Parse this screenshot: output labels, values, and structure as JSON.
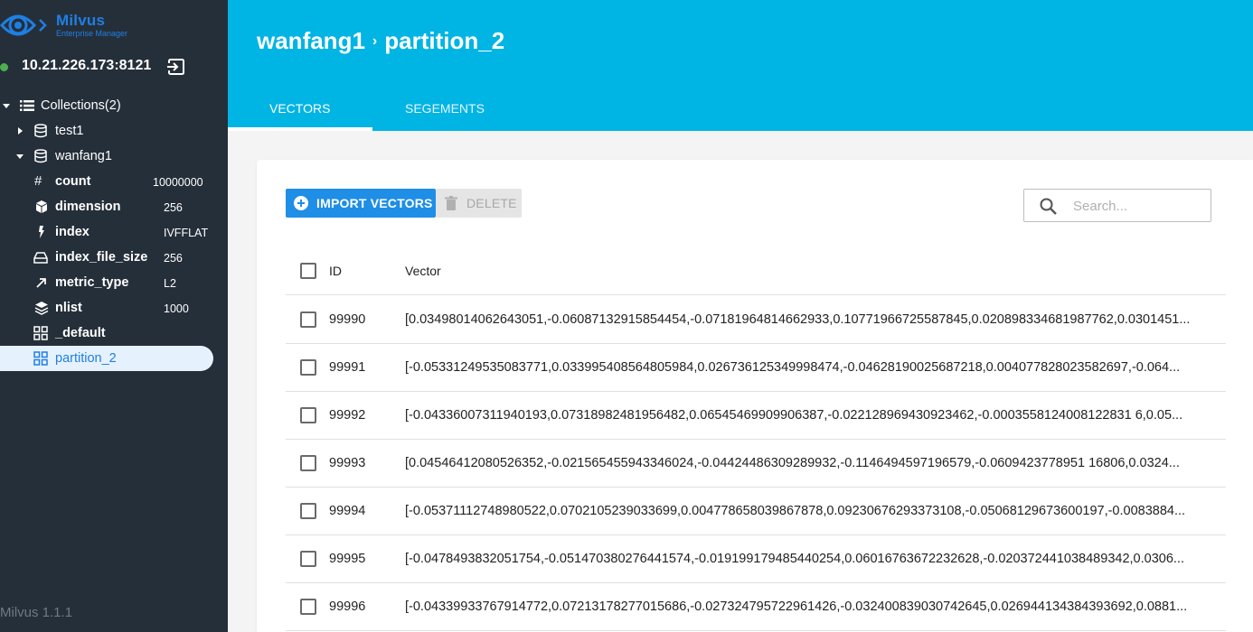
{
  "app": {
    "title": "Milvus",
    "subtitle": "Enterprise Manager",
    "version": "Milvus 1.1.1"
  },
  "connection": {
    "host": "10.21.226.173:8121",
    "status_color": "#4caf50"
  },
  "sidebar": {
    "collections_label": "Collections(2)",
    "collections": [
      {
        "label": "test1",
        "expanded": false
      },
      {
        "label": "wanfang1",
        "expanded": true,
        "properties": [
          {
            "key": "count",
            "value": "10000000",
            "icon": "hash-icon"
          },
          {
            "key": "dimension",
            "value": "256",
            "icon": "cube-icon"
          },
          {
            "key": "index",
            "value": "IVFFLAT",
            "icon": "bolt-icon"
          },
          {
            "key": "index_file_size",
            "value": "256",
            "icon": "drive-icon"
          },
          {
            "key": "metric_type",
            "value": "L2",
            "icon": "arrow-up-right-icon"
          },
          {
            "key": "nlist",
            "value": "1000",
            "icon": "layers-icon"
          }
        ],
        "partitions": [
          {
            "label": "_default",
            "selected": false
          },
          {
            "label": "partition_2",
            "selected": true
          }
        ]
      }
    ]
  },
  "header": {
    "breadcrumb": [
      "wanfang1",
      "partition_2"
    ],
    "tabs": [
      {
        "label": "Vectors",
        "active": true
      },
      {
        "label": "Segements",
        "active": false
      }
    ],
    "background_color": "#00b4e4"
  },
  "toolbar": {
    "import_label": "IMPORT VECTORS",
    "delete_label": "DELETE",
    "search_placeholder": "Search..."
  },
  "table": {
    "columns": [
      "ID",
      "Vector"
    ],
    "rows": [
      {
        "id": "99990",
        "vector": "[0.03498014062643051,-0.06087132915854454,-0.07181964814662933,0.10771966725587845,0.020898334681987762,0.0301451..."
      },
      {
        "id": "99991",
        "vector": "[-0.05331249535083771,0.033995408564805984,0.026736125349998474,-0.04628190025687218,0.004077828023582697,-0.064..."
      },
      {
        "id": "99992",
        "vector": "[-0.04336007311940193,0.07318982481956482,0.06545469909906387,-0.022128969430923462,-0.0003558124008122831 6,0.05..."
      },
      {
        "id": "99993",
        "vector": "[0.04546412080526352,-0.021565455943346024,-0.04424486309289932,-0.1146494597196579,-0.0609423778951 16806,0.0324..."
      },
      {
        "id": "99994",
        "vector": "[-0.05371112748980522,0.0702105239033699,0.004778658039867878,0.09230676293373108,-0.05068129673600197,-0.0083884..."
      },
      {
        "id": "99995",
        "vector": "[-0.0478493832051754,-0.051470380276441574,-0.019199179485440254,0.06016763672232628,-0.020372441038489342,0.0306..."
      },
      {
        "id": "99996",
        "vector": "[-0.04339933767914772,0.07213178277015686,-0.027324795722961426,-0.032400839030742645,0.026944134384393692,0.0881..."
      }
    ]
  }
}
